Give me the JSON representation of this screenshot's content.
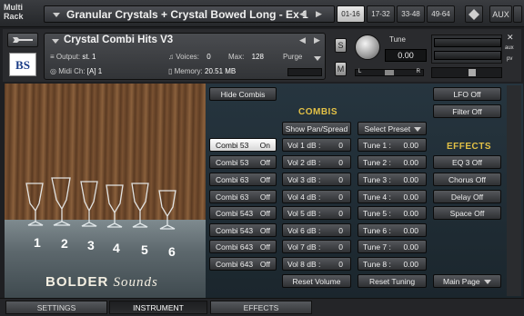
{
  "topbar": {
    "app_label": "Multi Rack",
    "rack_name": "Granular Crystals + Crystal Bowed Long - Ex 1",
    "pages": [
      "01-16",
      "17-32",
      "33-48",
      "49-64"
    ],
    "selected_page": "01-16",
    "aux_label": "AUX"
  },
  "instrument": {
    "logo_text": "BS",
    "title": "Crystal Combi Hits V3",
    "output_label": "Output:",
    "output_value": "st. 1",
    "voices_label": "Voices:",
    "voices_value": "0",
    "max_label": "Max:",
    "max_value": "128",
    "purge_label": "Purge",
    "midi_label": "Midi Ch:",
    "midi_value": "[A]  1",
    "memory_label": "Memory:",
    "memory_value": "20.51 MB",
    "s_label": "S",
    "m_label": "M",
    "tune_label": "Tune",
    "tune_value": "0.00",
    "pan_left": "L",
    "pan_right": "R",
    "aux_side_label": "aux",
    "pv_label": "pv"
  },
  "image": {
    "brand_text": "BOLDER",
    "brand_script": "Sounds",
    "glass_numbers": [
      "1",
      "2",
      "3",
      "4",
      "5",
      "6"
    ]
  },
  "combis_panel": {
    "hide_button": "Hide Combis",
    "heading": "COMBIS",
    "show_pan_button": "Show Pan/Spread",
    "select_preset_button": "Select Preset",
    "combis": [
      {
        "name": "Combi 53",
        "state": "On",
        "selected": true
      },
      {
        "name": "Combi 53",
        "state": "Off"
      },
      {
        "name": "Combi 63",
        "state": "Off"
      },
      {
        "name": "Combi 63",
        "state": "Off"
      },
      {
        "name": "Combi 543",
        "state": "Off"
      },
      {
        "name": "Combi 543",
        "state": "Off"
      },
      {
        "name": "Combi 643",
        "state": "Off"
      },
      {
        "name": "Combi 643",
        "state": "Off"
      }
    ],
    "volumes": [
      {
        "label": "Vol 1  dB :",
        "value": "0"
      },
      {
        "label": "Vol 2  dB :",
        "value": "0"
      },
      {
        "label": "Vol 3  dB :",
        "value": "0"
      },
      {
        "label": "Vol 4  dB :",
        "value": "0"
      },
      {
        "label": "Vol 5  dB :",
        "value": "0"
      },
      {
        "label": "Vol 6  dB :",
        "value": "0"
      },
      {
        "label": "Vol 7  dB :",
        "value": "0"
      },
      {
        "label": "Vol 8  dB :",
        "value": "0"
      }
    ],
    "tunes": [
      {
        "label": "Tune 1 :",
        "value": "0.00"
      },
      {
        "label": "Tune 2 :",
        "value": "0.00"
      },
      {
        "label": "Tune 3 :",
        "value": "0.00"
      },
      {
        "label": "Tune 4 :",
        "value": "0.00"
      },
      {
        "label": "Tune 5 :",
        "value": "0.00"
      },
      {
        "label": "Tune 6 :",
        "value": "0.00"
      },
      {
        "label": "Tune 7 :",
        "value": "0.00"
      },
      {
        "label": "Tune 8 :",
        "value": "0.00"
      }
    ],
    "reset_volume_button": "Reset Volume",
    "reset_tuning_button": "Reset Tuning"
  },
  "effects_panel": {
    "lfo_button": "LFO Off",
    "filter_button": "Filter Off",
    "heading": "EFFECTS",
    "buttons": [
      "EQ 3 Off",
      "Chorus Off",
      "Delay Off",
      "Space Off"
    ],
    "main_page_button": "Main Page"
  },
  "bottom_tabs": {
    "settings": "SETTINGS",
    "instrument": "INSTRUMENT",
    "effects": "EFFECTS"
  },
  "colors": {
    "accent_heading": "#e3c146",
    "panel_bg": "#1b262d"
  }
}
